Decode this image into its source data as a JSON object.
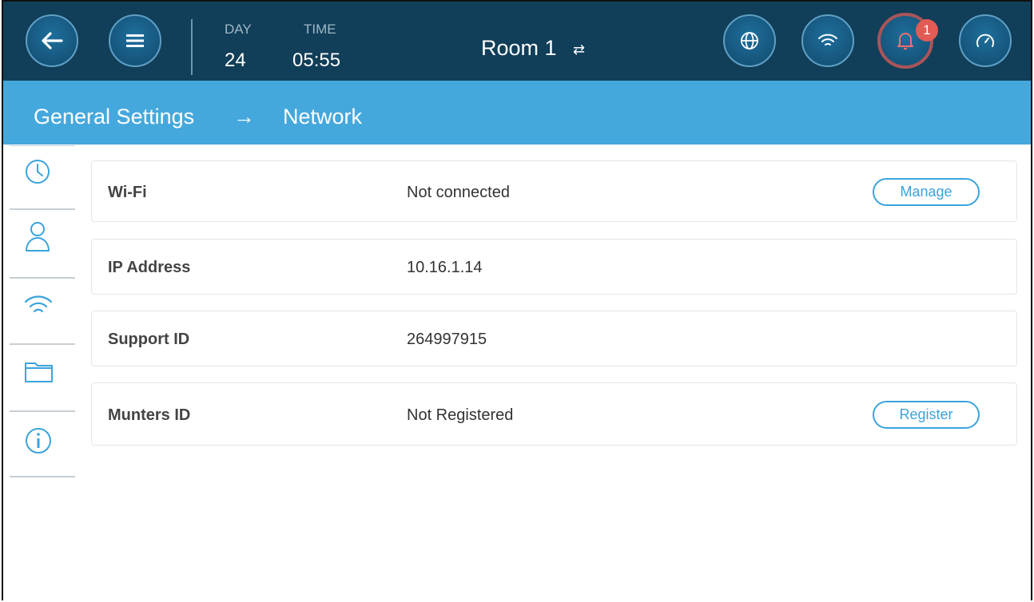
{
  "header": {
    "day_label": "DAY",
    "day_value": "24",
    "time_label": "TIME",
    "time_value": "05:55",
    "room": "Room 1",
    "room_swap_glyph": "⇄",
    "alarm_count": "1",
    "icons": [
      "back-arrow-icon",
      "menu-icon",
      "globe-icon",
      "wifi-icon",
      "bell-icon",
      "gauge-icon"
    ]
  },
  "breadcrumb": {
    "parent": "General Settings",
    "separator": "→",
    "current": "Network"
  },
  "sidebar": {
    "items": [
      "clock-icon",
      "user-icon",
      "wifi-icon",
      "folder-icon",
      "info-icon"
    ]
  },
  "network": {
    "rows": [
      {
        "label": "Wi-Fi",
        "value": "Not connected",
        "action": "Manage"
      },
      {
        "label": "IP Address",
        "value": "10.16.1.14"
      },
      {
        "label": "Support ID",
        "value": "264997915"
      },
      {
        "label": "Munters ID",
        "value": "Not Registered",
        "action": "Register"
      }
    ]
  },
  "colors": {
    "header_bg": "#113e58",
    "breadcrumb_bg": "#45a8dd",
    "accent": "#3ba3dc",
    "alarm_ring": "#a85559",
    "badge": "#e25b55"
  }
}
